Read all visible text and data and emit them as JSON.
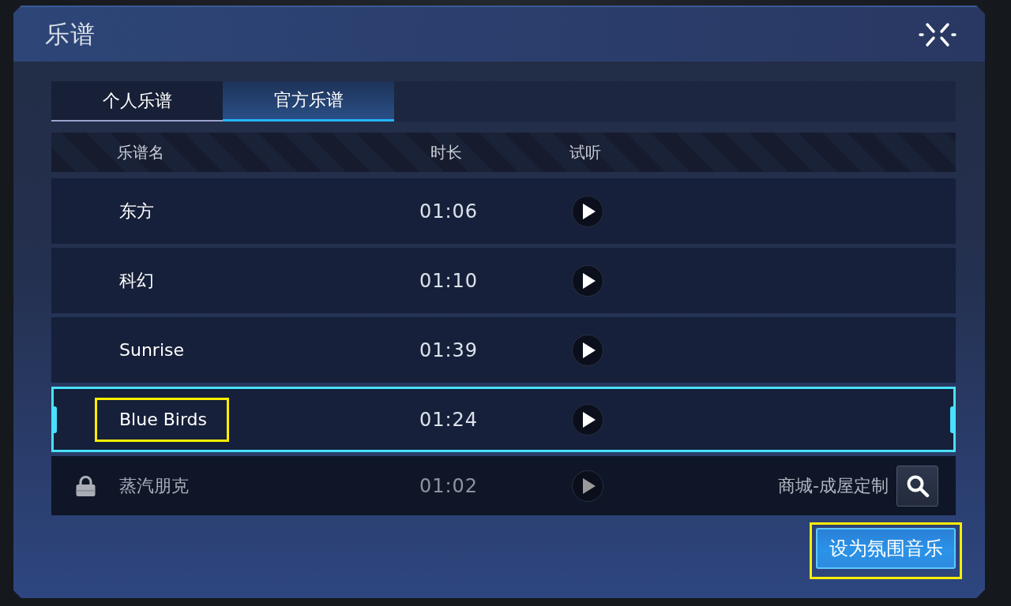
{
  "window": {
    "title": "乐谱"
  },
  "tabs": [
    {
      "label": "个人乐谱",
      "selected": false
    },
    {
      "label": "官方乐谱",
      "selected": true
    }
  ],
  "table": {
    "columns": [
      "乐谱名",
      "时长",
      "试听"
    ],
    "rows": [
      {
        "name": "东方",
        "duration": "01:06",
        "selected": false,
        "locked": false,
        "highlighted": false
      },
      {
        "name": "科幻",
        "duration": "01:10",
        "selected": false,
        "locked": false,
        "highlighted": false
      },
      {
        "name": "Sunrise",
        "duration": "01:39",
        "selected": false,
        "locked": false,
        "highlighted": false
      },
      {
        "name": "Blue Birds",
        "duration": "01:24",
        "selected": true,
        "locked": false,
        "highlighted": true
      },
      {
        "name": "蒸汽朋克",
        "duration": "01:02",
        "selected": false,
        "locked": true,
        "highlighted": false,
        "unlock_source": "商城-成屋定制"
      }
    ]
  },
  "action_button": {
    "label": "设为氛围音乐",
    "highlighted": true
  }
}
